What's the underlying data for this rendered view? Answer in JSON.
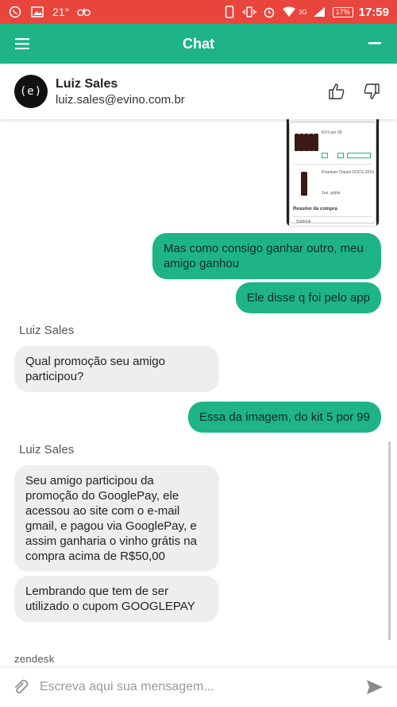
{
  "status_bar": {
    "temperature": "21°",
    "network": "3G",
    "battery": "17%",
    "time": "17:59",
    "icons": [
      "whatsapp-icon",
      "gallery-icon",
      "carrier-logo-icon",
      "phone-icon",
      "vibrate-icon",
      "alarm-icon",
      "wifi-icon",
      "signal-icon",
      "battery-icon"
    ]
  },
  "app_bar": {
    "title": "Chat",
    "background": "#1eb486"
  },
  "agent": {
    "avatar_text": "(e)",
    "name": "Luiz Sales",
    "email": "luiz.sales@evino.com.br"
  },
  "attachment": {
    "kit_label": "Kit 5 por 99",
    "product_name": "Premium Chianti DOCG 2016",
    "free_label": "1un. grátis",
    "summary_title": "Resumo da compra",
    "subtotal_label": "Subtotal"
  },
  "messages": [
    {
      "from": "user",
      "text": "Mas como consigo ganhar outro, meu amigo ganhou"
    },
    {
      "from": "user",
      "text": "Ele disse q foi pelo app"
    },
    {
      "from": "agent",
      "sender": "Luiz Sales",
      "text": "Qual promoção seu amigo participou?"
    },
    {
      "from": "user",
      "text": "Essa da imagem, do kit 5 por 99"
    },
    {
      "from": "agent",
      "sender": "Luiz Sales",
      "text": "Seu amigo participou da promoção do GooglePay, ele acessou ao site com o e-mail gmail, e pagou via GooglePay, e assim ganharia o vinho grátis na compra acima de R$50,00"
    },
    {
      "from": "agent",
      "text": "Lembrando que tem de ser utilizado o cupom GOOGLEPAY"
    }
  ],
  "footer": {
    "brand": "zendesk",
    "input_placeholder": "Escreva aqui sua mensagem..."
  },
  "colors": {
    "accent": "#1eb486",
    "status_bar": "#e8453c",
    "agent_bubble": "#eeeeee"
  }
}
